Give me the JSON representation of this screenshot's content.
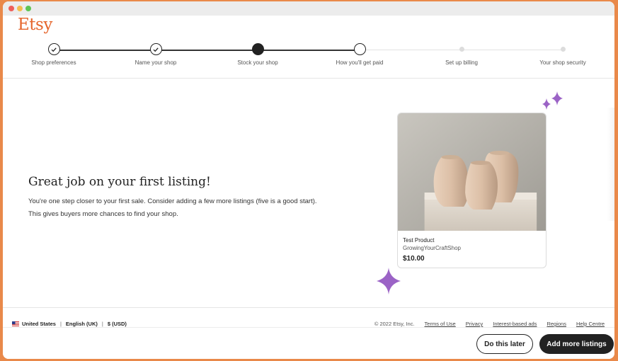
{
  "header": {
    "logo": "Etsy"
  },
  "stepper": {
    "steps": [
      {
        "label": "Shop preferences",
        "state": "complete"
      },
      {
        "label": "Name your shop",
        "state": "complete"
      },
      {
        "label": "Stock your shop",
        "state": "current"
      },
      {
        "label": "How you'll get paid",
        "state": "next"
      },
      {
        "label": "Set up billing",
        "state": "pending"
      },
      {
        "label": "Your shop security",
        "state": "pending"
      }
    ]
  },
  "main": {
    "headline": "Great job on your first listing!",
    "body_line1": "You're one step closer to your first sale. Consider adding a few more listings (five is a good start).",
    "body_line2": "This gives buyers more chances to find your shop."
  },
  "listing_card": {
    "title": "Test Product",
    "shop": "GrowingYourCraftShop",
    "price": "$10.00"
  },
  "footer": {
    "country": "United States",
    "language": "English (UK)",
    "currency": "$ (USD)",
    "copyright": "© 2022 Etsy, Inc.",
    "links": [
      "Terms of Use",
      "Privacy",
      "Interest-based ads",
      "Regions",
      "Help Centre"
    ]
  },
  "actions": {
    "secondary_label": "Do this later",
    "primary_label": "Add more listings"
  },
  "colors": {
    "brand": "#e5652b",
    "sparkle": "#9b63c6",
    "frame": "#e9894a"
  }
}
